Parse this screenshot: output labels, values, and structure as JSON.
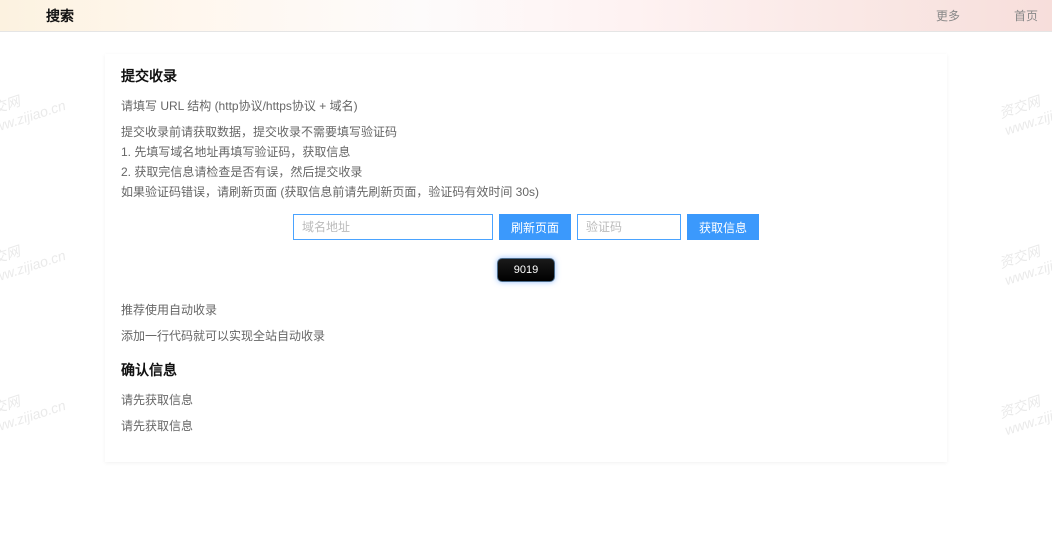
{
  "watermark": {
    "line1": "资交网",
    "line2": "www.zijiao.cn"
  },
  "nav": {
    "brand": "搜索",
    "more": "更多",
    "home": "首页"
  },
  "submit": {
    "title": "提交收录",
    "url_hint": "请填写 URL 结构 (http协议/https协议 + 域名)",
    "pre_hint": "提交收录前请获取数据，提交收录不需要填写验证码",
    "step1": "1. 先填写域名地址再填写验证码，获取信息",
    "step2": "2. 获取完信息请检查是否有误，然后提交收录",
    "err_hint": "如果验证码错误，请刷新页面 (获取信息前请先刷新页面，验证码有效时间 30s)",
    "domain_placeholder": "域名地址",
    "refresh_btn": "刷新页面",
    "captcha_placeholder": "验证码",
    "fetch_btn": "获取信息",
    "toast": "9019"
  },
  "reco": {
    "l1": "推荐使用自动收录",
    "l2": "添加一行代码就可以实现全站自动收录"
  },
  "confirm": {
    "title": "确认信息",
    "l1": "请先获取信息",
    "l2": "请先获取信息"
  }
}
